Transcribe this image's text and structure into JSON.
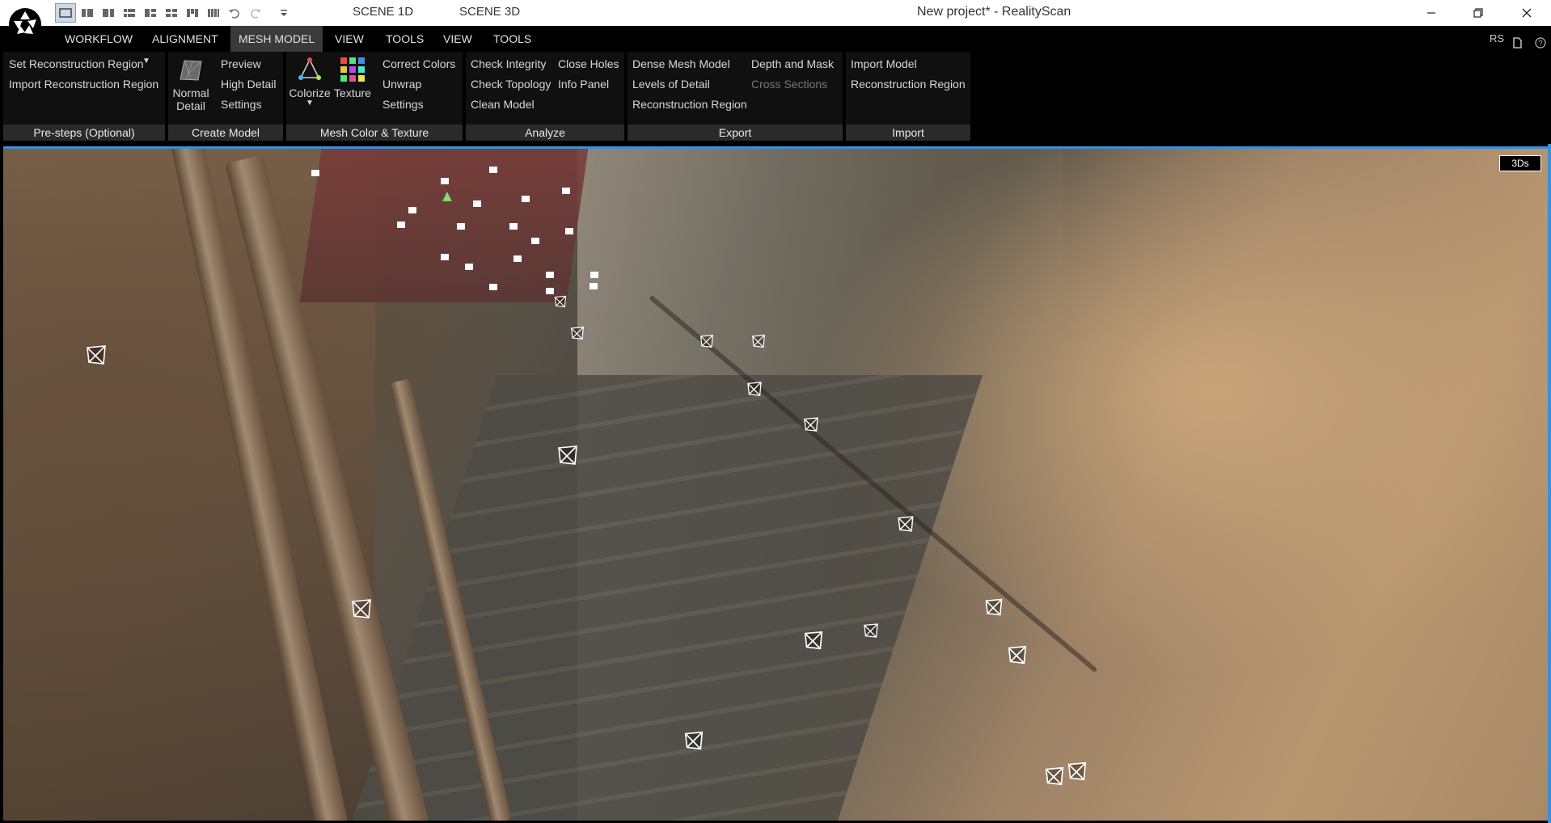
{
  "window": {
    "title": "New project* - RealityScan",
    "scene_tabs": [
      "SCENE 1D",
      "SCENE 3D"
    ]
  },
  "menubar": {
    "items": [
      "WORKFLOW",
      "ALIGNMENT",
      "MESH MODEL",
      "VIEW",
      "TOOLS",
      "VIEW",
      "TOOLS"
    ],
    "active": "MESH MODEL",
    "right_label": "RS"
  },
  "ribbon": {
    "pre_steps": {
      "footer": "Pre-steps (Optional)",
      "set_region": "Set Reconstruction Region",
      "import_region": "Import Reconstruction Region"
    },
    "create_model": {
      "footer": "Create Model",
      "normal": "Normal",
      "detail": "Detail",
      "preview": "Preview",
      "high_detail": "High Detail",
      "settings": "Settings"
    },
    "mesh_color": {
      "footer": "Mesh Color & Texture",
      "colorize": "Colorize",
      "texture": "Texture",
      "correct_colors": "Correct Colors",
      "unwrap": "Unwrap",
      "settings": "Settings"
    },
    "analyze": {
      "footer": "Analyze",
      "check_integrity": "Check Integrity",
      "check_topology": "Check Topology",
      "clean_model": "Clean Model",
      "close_holes": "Close Holes",
      "info_panel": "Info Panel"
    },
    "export": {
      "footer": "Export",
      "dense_mesh": "Dense Mesh Model",
      "levels_of_detail": "Levels of Detail",
      "reconstruction_region": "Reconstruction Region",
      "depth_mask": "Depth and Mask",
      "cross_sections": "Cross Sections"
    },
    "import": {
      "footer": "Import",
      "import_model": "Import Model",
      "reconstruction_region": "Reconstruction Region"
    }
  },
  "viewport": {
    "badge": "3Ds"
  }
}
